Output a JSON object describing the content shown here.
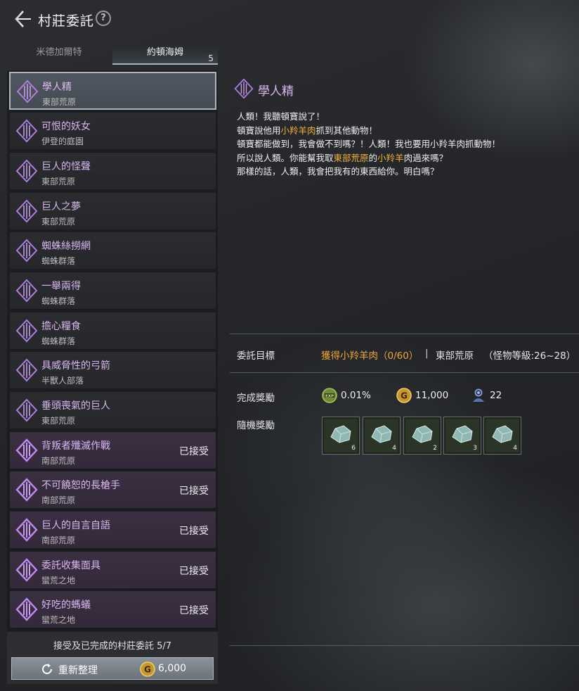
{
  "header": {
    "title": "村莊委託",
    "help": "?"
  },
  "tabs": [
    {
      "label": "米德加爾特"
    },
    {
      "label": "約頓海姆",
      "badge": "5"
    }
  ],
  "quests": [
    {
      "title": "學人精",
      "location": "東部荒原",
      "status": ""
    },
    {
      "title": "可恨的妖女",
      "location": "伊登的庭園",
      "status": ""
    },
    {
      "title": "巨人的怪聲",
      "location": "東部荒原",
      "status": ""
    },
    {
      "title": "巨人之夢",
      "location": "東部荒原",
      "status": ""
    },
    {
      "title": "蜘蛛絲撈網",
      "location": "蜘蛛群落",
      "status": ""
    },
    {
      "title": "一舉兩得",
      "location": "蜘蛛群落",
      "status": ""
    },
    {
      "title": "擔心糧食",
      "location": "蜘蛛群落",
      "status": ""
    },
    {
      "title": "具威脅性的弓箭",
      "location": "半獸人部落",
      "status": ""
    },
    {
      "title": "垂頭喪氣的巨人",
      "location": "東部荒原",
      "status": ""
    },
    {
      "title": "背叛者殲滅作戰",
      "location": "南部荒原",
      "status": "已接受"
    },
    {
      "title": "不可饒恕的長槍手",
      "location": "南部荒原",
      "status": "已接受"
    },
    {
      "title": "巨人的自言自語",
      "location": "南部荒原",
      "status": "已接受"
    },
    {
      "title": "委託收集面具",
      "location": "蠻荒之地",
      "status": "已接受"
    },
    {
      "title": "好吃的螞蟻",
      "location": "蠻荒之地",
      "status": "已接受"
    }
  ],
  "footer": {
    "count_text": "接受及已完成的村莊委託 5/7",
    "refresh_label": "重新整理",
    "refresh_cost": "6,000"
  },
  "detail": {
    "title": "學人精",
    "description": {
      "l1": "人類！我聽頓寶說了！",
      "l2a": "頓寶說他用",
      "l2b": "小羚羊肉",
      "l2c": "抓到其他動物！",
      "l3": "頓寶都能做到，我會做不到嗎？！人類！我也要用小羚羊肉抓動物！",
      "l4a": "所以說人類。你能幫我取",
      "l4b": "東部荒原",
      "l4c": "的",
      "l4d": "小羚羊",
      "l4e": "肉過來嗎？",
      "l5": "那樣的話，人類，我會把我有的東西給你。明白嗎？"
    },
    "objective": {
      "label": "委託目標",
      "target": "獲得小羚羊肉（0/60）",
      "separator": "|",
      "region": "東部荒原",
      "level": "（怪物等級:26~28）"
    },
    "rewards": {
      "label": "完成獎勵",
      "exp": "0.01%",
      "gold": "11,000",
      "contribution": "22"
    },
    "random_rewards": {
      "label": "隨機獎勵",
      "items": [
        {
          "icon": "ore-icon",
          "count": "6"
        },
        {
          "icon": "ore-icon",
          "count": "4"
        },
        {
          "icon": "ore-icon",
          "count": "2"
        },
        {
          "icon": "ore-icon",
          "count": "3"
        },
        {
          "icon": "ore-icon",
          "count": "4"
        }
      ]
    }
  },
  "colors": {
    "quest_title": "#d8b6ee",
    "highlight": "#f0b33a",
    "objective": "#f0a63a",
    "accepted_bg": "#3a3042"
  }
}
